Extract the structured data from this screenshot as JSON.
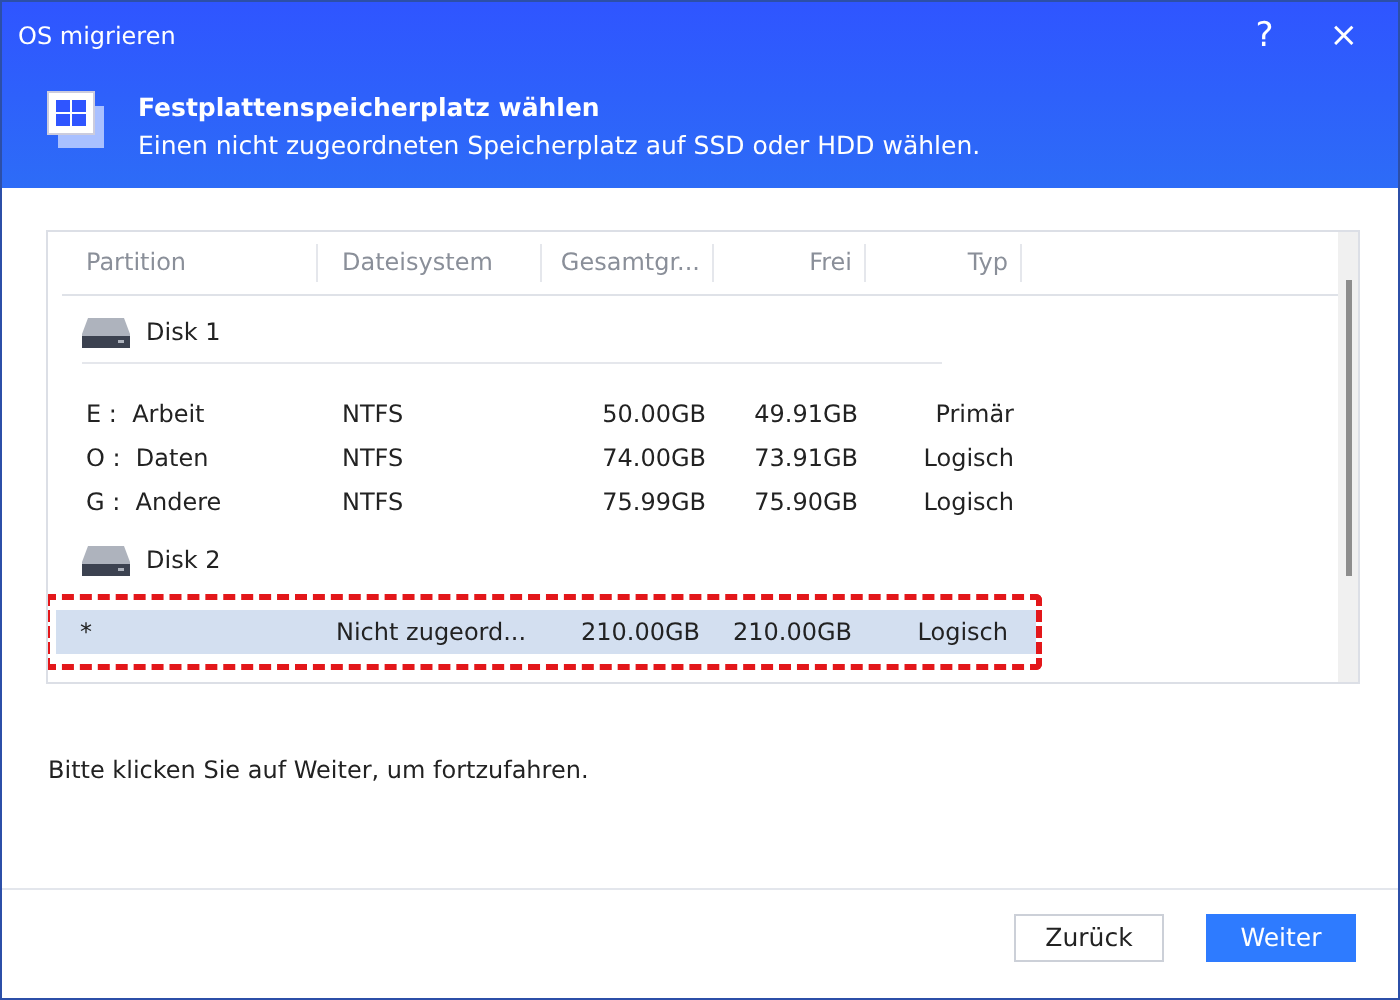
{
  "window": {
    "title": "OS migrieren",
    "help": "?",
    "close": "×"
  },
  "header": {
    "title": "Festplattenspeicherplatz wählen",
    "subtitle": "Einen nicht zugeordneten Speicherplatz auf SSD oder HDD wählen."
  },
  "table": {
    "columns": [
      "Partition",
      "Dateisystem",
      "Gesamtgr...",
      "Frei",
      "Typ"
    ],
    "disks": [
      {
        "name": "Disk 1",
        "partitions": [
          {
            "cells": [
              "E :  Arbeit",
              "NTFS",
              "50.00GB",
              "49.91GB",
              "Primär"
            ],
            "selected": false
          },
          {
            "cells": [
              "O :  Daten",
              "NTFS",
              "74.00GB",
              "73.91GB",
              "Logisch"
            ],
            "selected": false
          },
          {
            "cells": [
              "G :  Andere",
              "NTFS",
              "75.99GB",
              "75.90GB",
              "Logisch"
            ],
            "selected": false
          }
        ]
      },
      {
        "name": "Disk 2",
        "partitions": [
          {
            "cells": [
              "*",
              "Nicht zugeord...",
              "210.00GB",
              "210.00GB",
              "Logisch"
            ],
            "selected": true
          }
        ]
      }
    ]
  },
  "instruction": "Bitte klicken Sie auf Weiter, um fortzufahren.",
  "buttons": [
    {
      "label": "Zurück",
      "kind": "secondary"
    },
    {
      "label": "Weiter",
      "kind": "primary"
    }
  ]
}
